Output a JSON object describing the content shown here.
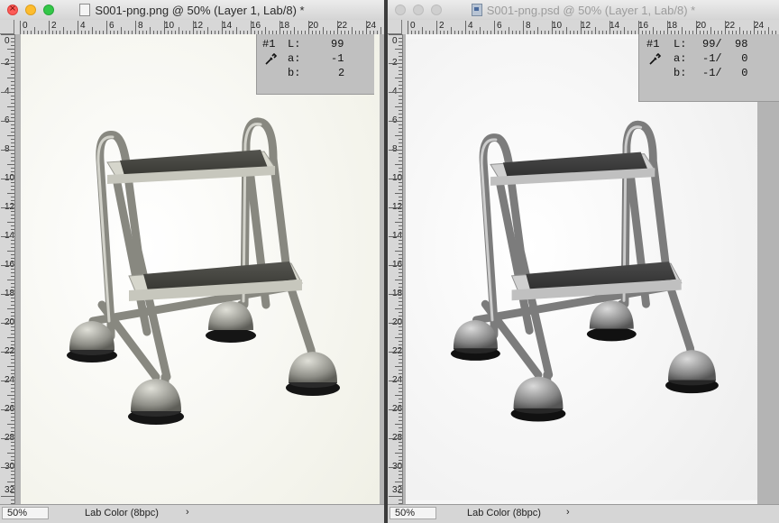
{
  "left_window": {
    "title": "S001-png.png @ 50% (Layer 1, Lab/8) *",
    "info": {
      "sample": "#1",
      "L_label": "L:",
      "L": "99",
      "a_label": "a:",
      "a": "-1",
      "b_label": "b:",
      "b": "2"
    },
    "status": {
      "zoom": "50%",
      "doc_info": "Lab Color (8bpc)",
      "arrow": "›"
    }
  },
  "right_window": {
    "title": "S001-png.psd @ 50% (Layer 1, Lab/8) *",
    "info": {
      "sample": "#1",
      "L_label": "L:",
      "L": "99/  98",
      "a_label": "a:",
      "a": "-1/   0",
      "b_label": "b:",
      "b": "-1/   0"
    },
    "status": {
      "zoom": "50%",
      "doc_info": "Lab Color (8bpc)",
      "arrow": "›"
    }
  },
  "ruler": {
    "h_labels": [
      "0",
      "2",
      "4",
      "6",
      "8",
      "10",
      "12",
      "14",
      "16",
      "18",
      "20",
      "22",
      "24"
    ],
    "v_labels": [
      "0",
      "2",
      "4",
      "6",
      "8",
      "10",
      "12",
      "14",
      "16",
      "18",
      "20",
      "22",
      "24",
      "26",
      "28",
      "30",
      "32"
    ]
  },
  "icons": {
    "close": "close-icon",
    "minimize": "minimize-icon",
    "zoom": "zoom-icon",
    "eyedropper": "eyedropper-icon",
    "document": "document-icon"
  }
}
